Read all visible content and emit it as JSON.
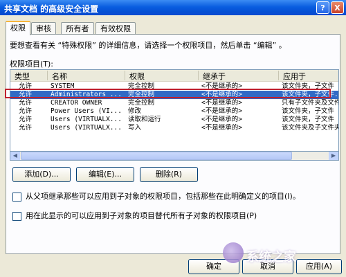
{
  "window": {
    "title": "共享文档 的高级安全设置",
    "help_glyph": "?",
    "close_glyph": "X"
  },
  "tabs": [
    {
      "label": "权限"
    },
    {
      "label": "审核"
    },
    {
      "label": "所有者"
    },
    {
      "label": "有效权限"
    }
  ],
  "description": "要想查看有关 “特殊权限” 的详细信息，请选择一个权限项目，然后单击 “编辑” 。",
  "list_label": "权限项目(T):",
  "columns": [
    "类型",
    "名称",
    "权限",
    "继承于",
    "应用于"
  ],
  "rows": [
    {
      "type": "允许",
      "name": "SYSTEM",
      "permission": "完全控制",
      "inherited": "<不是继承的>",
      "applies": "该文件夹，子文件"
    },
    {
      "type": "允许",
      "name": "Administrators ...",
      "permission": "完全控制",
      "inherited": "<不是继承的>",
      "applies": "该文件夹，子文件..."
    },
    {
      "type": "允许",
      "name": "CREATOR OWNER",
      "permission": "完全控制",
      "inherited": "<不是继承的>",
      "applies": "只有子文件夹及文件"
    },
    {
      "type": "允许",
      "name": "Power Users (VI...",
      "permission": "修改",
      "inherited": "<不是继承的>",
      "applies": "该文件夹，子文件"
    },
    {
      "type": "允许",
      "name": "Users (VIRTUALX...",
      "permission": "读取和运行",
      "inherited": "<不是继承的>",
      "applies": "该文件夹，子文件"
    },
    {
      "type": "允许",
      "name": "Users (VIRTUALX...",
      "permission": "写入",
      "inherited": "<不是继承的>",
      "applies": "该文件夹及子文件夹"
    }
  ],
  "selected_row_index": 1,
  "buttons": {
    "add": "添加(D)...",
    "edit": "编辑(E)...",
    "remove": "删除(R)",
    "ok": "确定",
    "cancel": "取消",
    "apply": "应用(A)"
  },
  "checkboxes": {
    "inherit": {
      "label": "从父项继承那些可以应用到子对象的权限项目，包括那些在此明确定义的项目(I)。",
      "checked": false
    },
    "replace": {
      "label": "用在此显示的可以应用到子对象的项目替代所有子对象的权限项目(P)",
      "checked": false
    }
  },
  "scroll": {
    "left_arrow": "◀",
    "right_arrow": "▶"
  },
  "watermark": "系统之家"
}
